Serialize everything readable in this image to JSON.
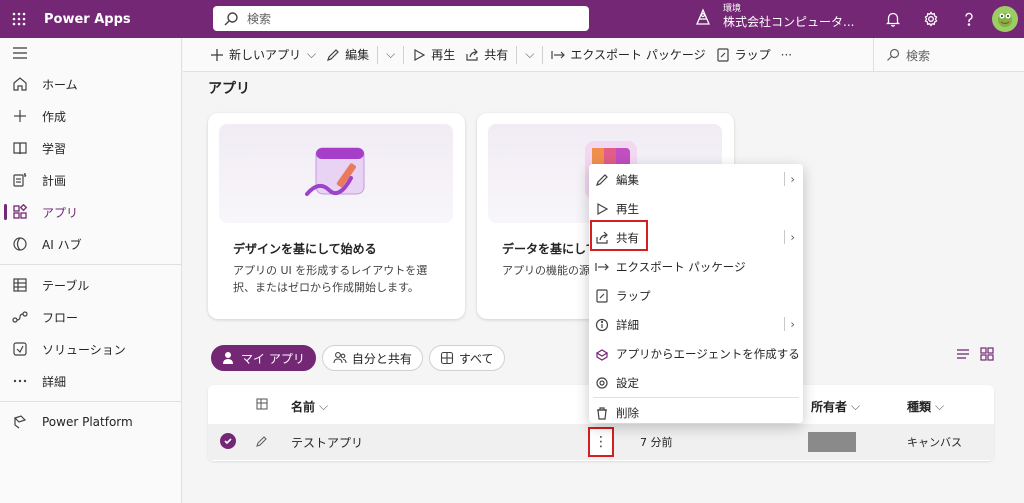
{
  "topbar": {
    "app_title": "Power Apps",
    "search_placeholder": "検索",
    "env_label": "環境",
    "env_name": "株式会社コンピュータ..."
  },
  "leftnav": {
    "items": [
      {
        "label": "ホーム",
        "icon": "home-icon"
      },
      {
        "label": "作成",
        "icon": "plus-icon"
      },
      {
        "label": "学習",
        "icon": "book-icon"
      },
      {
        "label": "計画",
        "icon": "plan-icon"
      },
      {
        "label": "アプリ",
        "icon": "apps-icon",
        "active": true
      },
      {
        "label": "AI ハブ",
        "icon": "ai-hub-icon"
      },
      {
        "label": "テーブル",
        "icon": "table-icon"
      },
      {
        "label": "フロー",
        "icon": "flow-icon"
      },
      {
        "label": "ソリューション",
        "icon": "solution-icon"
      },
      {
        "label": "詳細",
        "icon": "more-icon"
      },
      {
        "label": "Power Platform",
        "icon": "power-platform-icon"
      }
    ]
  },
  "cmdbar": {
    "new_app": "新しいアプリ",
    "edit": "編集",
    "play": "再生",
    "share": "共有",
    "export": "エクスポート パッケージ",
    "wrap": "ラップ",
    "more": "···",
    "search": "検索"
  },
  "main": {
    "title": "アプリ",
    "cards": [
      {
        "title": "デザインを基にして始める",
        "desc": "アプリの UI を形成するレイアウトを選択、またはゼロから作成開始します。"
      },
      {
        "title": "データを基にして",
        "desc": "アプリの機能の源択、またはテーブ"
      }
    ],
    "pills": [
      "マイ アプリ",
      "自分と共有",
      "すべて"
    ],
    "table": {
      "headers": {
        "name": "名前",
        "owner": "所有者",
        "type": "種類"
      },
      "row": {
        "name": "テストアプリ",
        "modified": "7 分前",
        "type": "キャンバス",
        "more": "⋮"
      }
    }
  },
  "context_menu": {
    "items": [
      {
        "label": "編集",
        "icon": "edit-icon",
        "submenu": true
      },
      {
        "label": "再生",
        "icon": "play-icon",
        "submenu": false
      },
      {
        "label": "共有",
        "icon": "share-icon",
        "submenu": true
      },
      {
        "label": "エクスポート パッケージ",
        "icon": "export-icon",
        "submenu": false
      },
      {
        "label": "ラップ",
        "icon": "wrap-icon",
        "submenu": false
      },
      {
        "label": "詳細",
        "icon": "info-icon",
        "submenu": true
      },
      {
        "label": "アプリからエージェントを作成する",
        "icon": "agent-icon",
        "submenu": false
      },
      {
        "label": "設定",
        "icon": "settings-icon",
        "submenu": false
      },
      {
        "label": "削除",
        "icon": "delete-icon",
        "submenu": false
      }
    ]
  },
  "colors": {
    "brand": "#742774",
    "highlight": "#d21f1f"
  }
}
